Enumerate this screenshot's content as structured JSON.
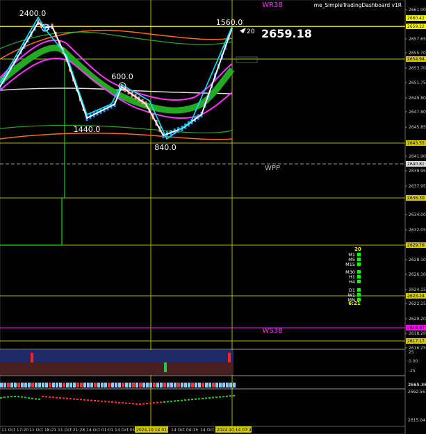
{
  "indicator_name": "me_SimpleTradingDashboard v1R",
  "current_price": "2659.18",
  "countdown_value": "20",
  "pivot_labels": {
    "wr38": "WR38",
    "wpp": "WPP",
    "ws38": "WS38"
  },
  "zigzag_labels": {
    "a": "2400.0",
    "b": "1560.0",
    "c": "600.0",
    "d": "1440.0",
    "e": "840.0"
  },
  "price_axis_ticks": [
    "2661.00",
    "2657.65",
    "2655.70",
    "2653.70",
    "2651.75",
    "2649.80",
    "2647.80",
    "2645.85",
    "2641.90",
    "2639.95",
    "2637.95",
    "2634.00",
    "2632.05",
    "2630.05",
    "2628.10",
    "2626.10",
    "2624.15",
    "2622.15",
    "2620.20",
    "2618.20",
    "2616.25"
  ],
  "price_axis_tags": [
    "2660.42",
    "2659.22",
    "2654.94",
    "2643.55",
    "2640.81",
    "2636.30",
    "2629.76",
    "2623.24",
    "2618.97",
    "2617.17"
  ],
  "oscillator_ticks": [
    "25",
    "0.00",
    "-25"
  ],
  "lower_axis_ticks": [
    "2665.3636",
    "2662.56",
    "2615.04"
  ],
  "timeframe_panel": {
    "count_label": "20",
    "timeframes": [
      "M1",
      "M5",
      "M15",
      "M30",
      "H1",
      "H4",
      "D1",
      "W1",
      "MN"
    ],
    "timer": "6:21"
  },
  "time_axis_labels": [
    "11 Oct 17:20",
    "11 Oct 18:21",
    "11 Oct 21:28",
    "14 Oct 01:01",
    "14 Oct 01:51",
    "14 Oct 04:15",
    "14 Oct"
  ],
  "time_axis_highlights": [
    "2024.10.14 01:34",
    "2024.10.14 07:48"
  ],
  "colors": {
    "background": "#000000",
    "yellow_line": "#ffff00",
    "up_brick": "#1e90ff",
    "down_brick": "#fa8072",
    "green_band": "#22aa22",
    "magenta": "#ff00ff",
    "orange": "#ff6a1a",
    "status_green": "#00ff00"
  }
}
